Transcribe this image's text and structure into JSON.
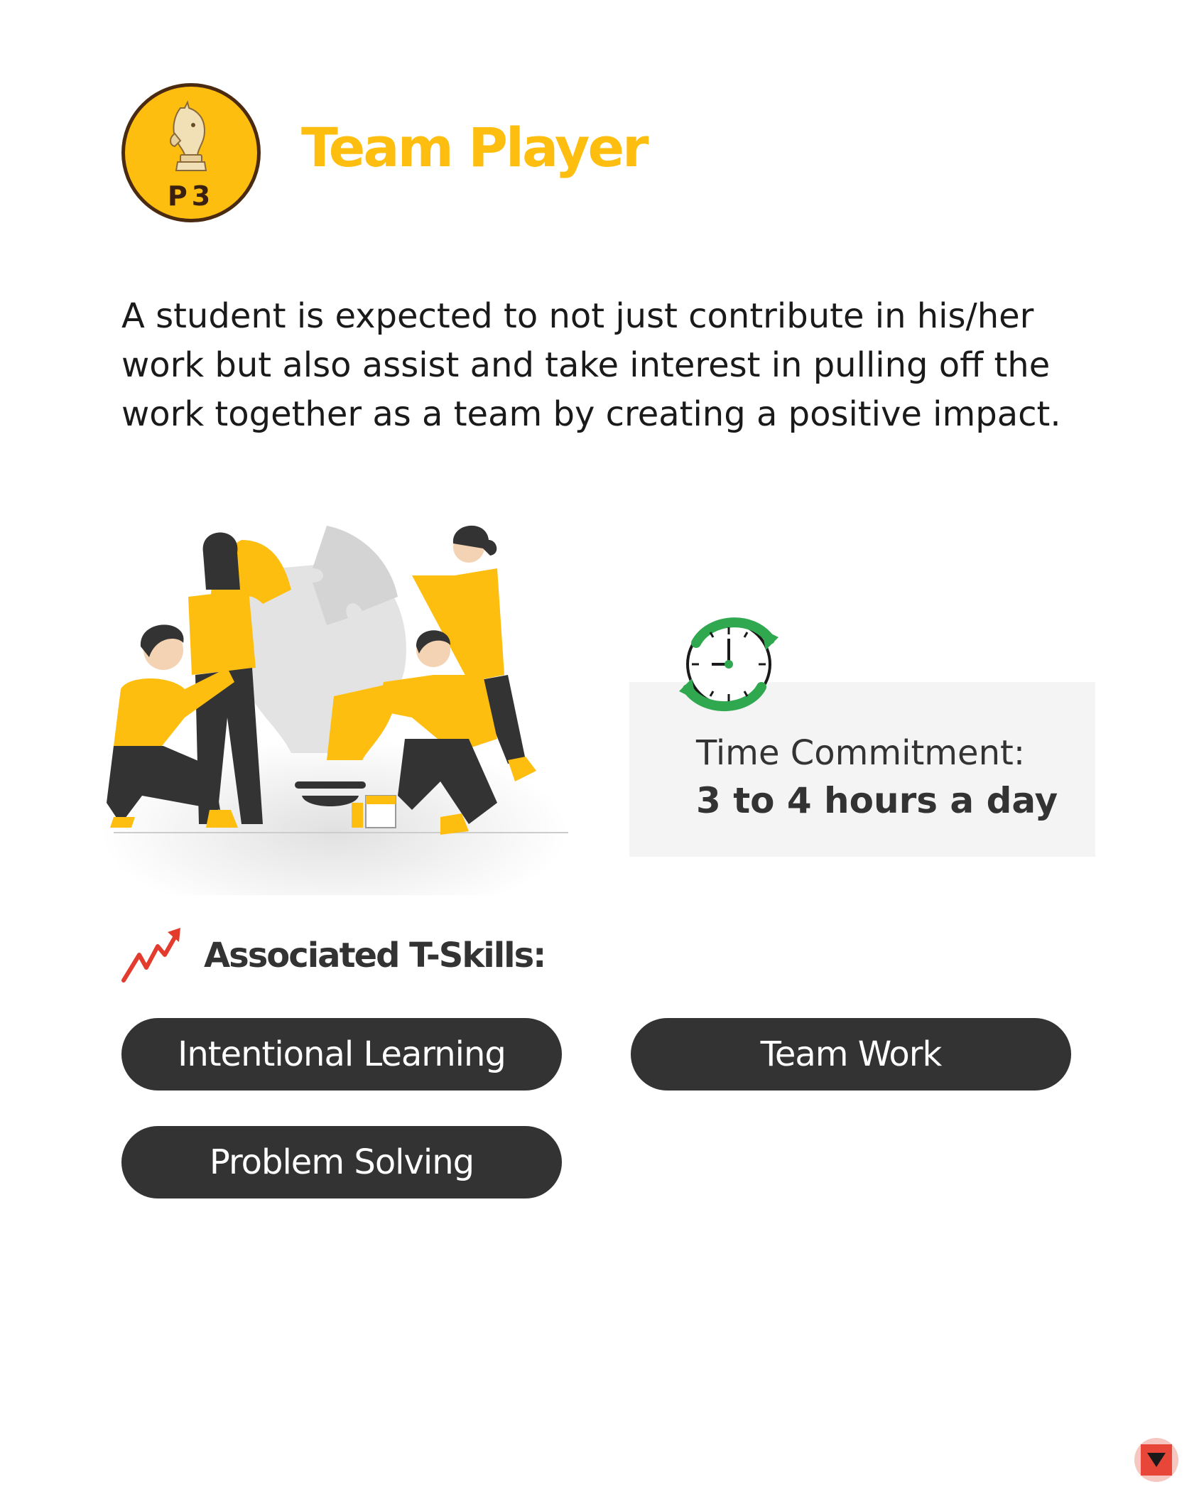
{
  "header": {
    "badge_code": "P3",
    "badge_icon": "chess-knight-icon",
    "title": "Team Player"
  },
  "description": "A student is expected to not just contribute in his/her work but also assist and take interest in pulling off the work together as a team by creating a positive impact.",
  "time": {
    "icon": "clock-refresh-icon",
    "label": "Time Commitment:",
    "value": "3 to 4 hours a day"
  },
  "skills": {
    "icon": "trend-up-icon",
    "heading": "Associated T-Skills:",
    "items": [
      {
        "label": "Intentional Learning"
      },
      {
        "label": "Team Work"
      },
      {
        "label": "Problem Solving"
      }
    ]
  },
  "colors": {
    "accent": "#FEBE10",
    "pill": "#333333",
    "badge_border": "#4a2a10",
    "scroll_button": "#e9463a"
  }
}
